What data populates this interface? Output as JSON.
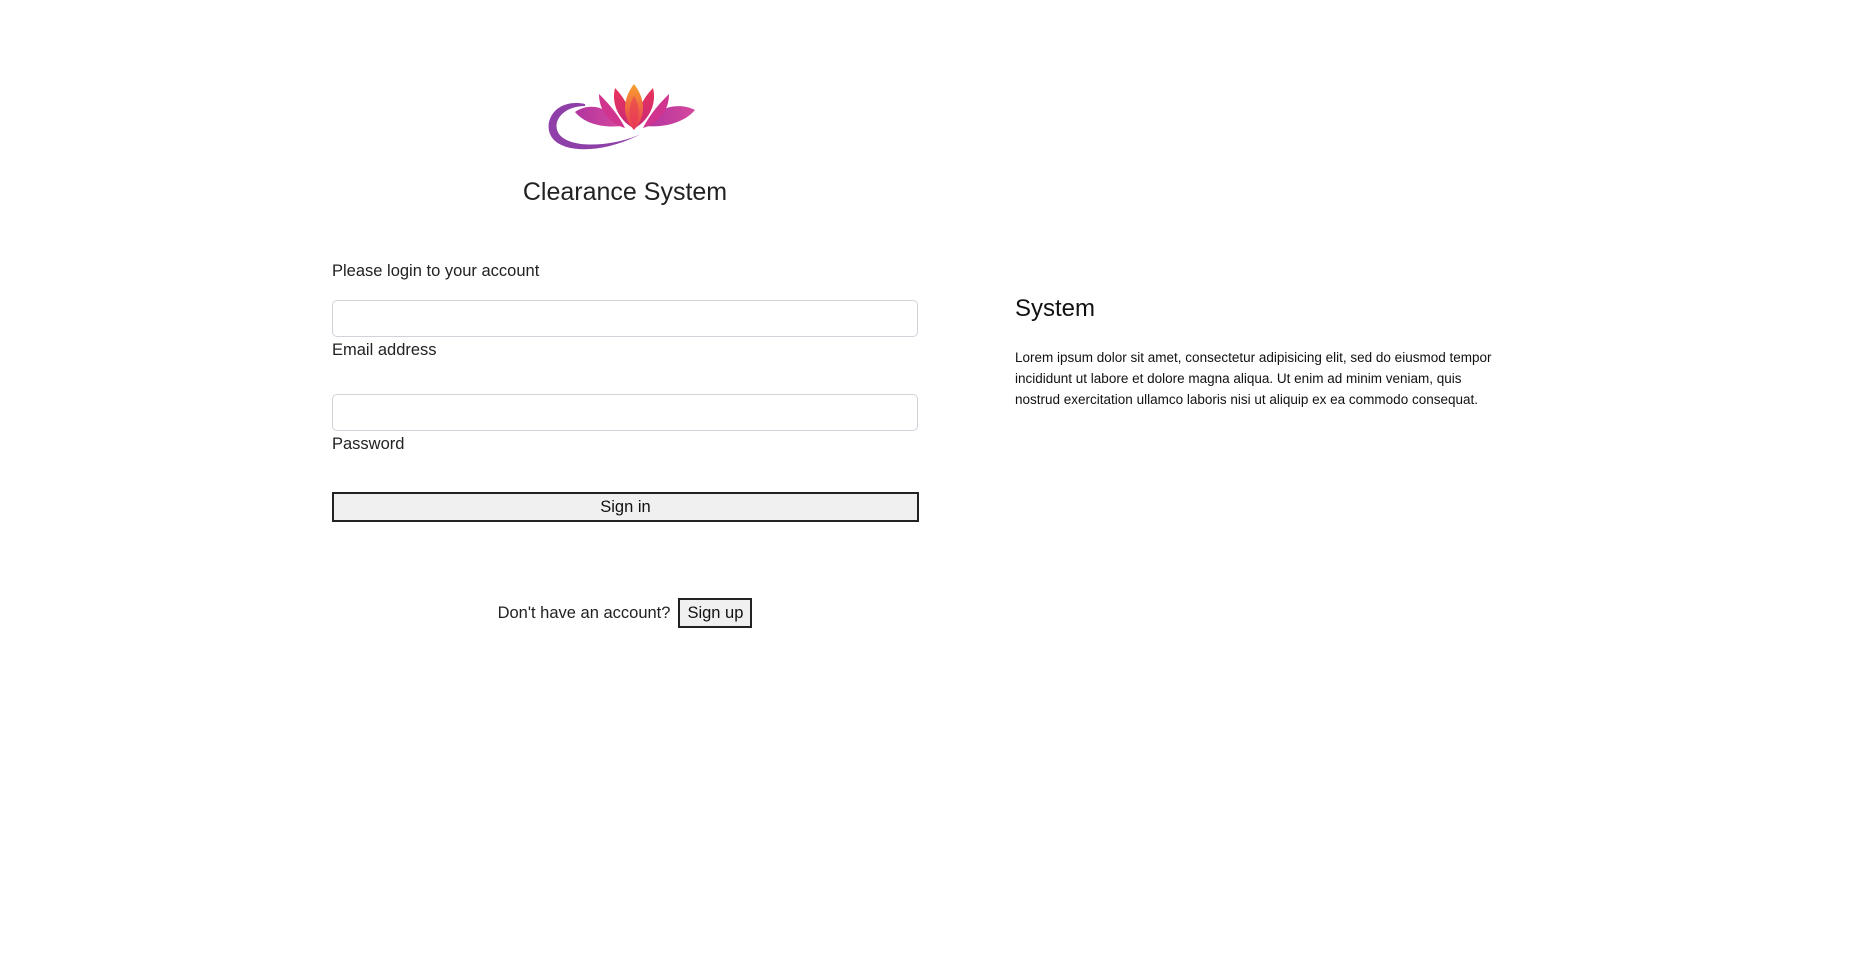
{
  "brand": {
    "title": "Clearance System",
    "logo_icon": "lotus-icon",
    "colors": {
      "swoosh": "#8e3fa8",
      "petal_outer": "#c2389f",
      "petal_inner": "#e8345a",
      "petal_center": "#f26a2a"
    }
  },
  "login": {
    "prompt": "Please login to your account",
    "email": {
      "label": "Email address",
      "value": "",
      "placeholder": ""
    },
    "password": {
      "label": "Password",
      "value": "",
      "placeholder": ""
    },
    "signin_label": "Sign in"
  },
  "signup": {
    "text": "Don't have an account?",
    "button_label": "Sign up"
  },
  "info": {
    "title": "System",
    "body": "Lorem ipsum dolor sit amet, consectetur adipisicing elit, sed do eiusmod tempor incididunt ut labore et dolore magna aliqua. Ut enim ad minim veniam, quis nostrud exercitation ullamco laboris nisi ut aliquip ex ea commodo consequat."
  }
}
